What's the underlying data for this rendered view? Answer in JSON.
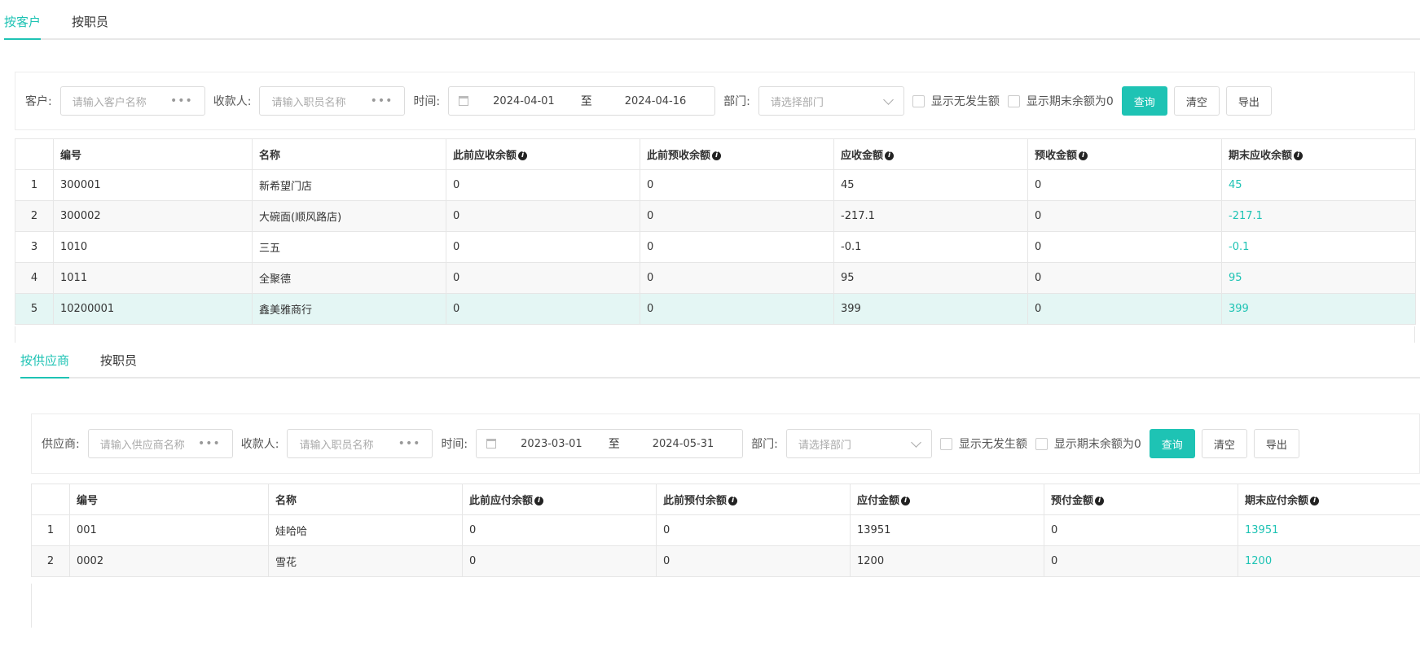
{
  "top": {
    "tabs": [
      "按客户",
      "按职员"
    ],
    "filter": {
      "customer_label": "客户:",
      "customer_placeholder": "请输入客户名称",
      "collector_label": "收款人:",
      "collector_placeholder": "请输入职员名称",
      "time_label": "时间:",
      "date_start": "2024-04-01",
      "date_sep": "至",
      "date_end": "2024-04-16",
      "dept_label": "部门:",
      "dept_placeholder": "请选择部门",
      "chk_no_activity": "显示无发生额",
      "chk_zero_end": "显示期末余额为0",
      "btn_query": "查询",
      "btn_clear": "清空",
      "btn_export": "导出"
    },
    "columns": [
      "编号",
      "名称",
      "此前应收余额",
      "此前预收余额",
      "应收金额",
      "预收金额",
      "期末应收余额"
    ],
    "rows": [
      {
        "idx": "1",
        "code": "300001",
        "name": "新希望门店",
        "prev_ar": "0",
        "prev_adv": "0",
        "amount": "45",
        "adv": "0",
        "end": "45"
      },
      {
        "idx": "2",
        "code": "300002",
        "name": "大碗面(顺风路店)",
        "prev_ar": "0",
        "prev_adv": "0",
        "amount": "-217.1",
        "adv": "0",
        "end": "-217.1"
      },
      {
        "idx": "3",
        "code": "1010",
        "name": "三五",
        "prev_ar": "0",
        "prev_adv": "0",
        "amount": "-0.1",
        "adv": "0",
        "end": "-0.1"
      },
      {
        "idx": "4",
        "code": "1011",
        "name": "全聚德",
        "prev_ar": "0",
        "prev_adv": "0",
        "amount": "95",
        "adv": "0",
        "end": "95"
      },
      {
        "idx": "5",
        "code": "10200001",
        "name": "鑫美雅商行",
        "prev_ar": "0",
        "prev_adv": "0",
        "amount": "399",
        "adv": "0",
        "end": "399"
      }
    ]
  },
  "bottom": {
    "tabs": [
      "按供应商",
      "按职员"
    ],
    "filter": {
      "supplier_label": "供应商:",
      "supplier_placeholder": "请输入供应商名称",
      "collector_label": "收款人:",
      "collector_placeholder": "请输入职员名称",
      "time_label": "时间:",
      "date_start": "2023-03-01",
      "date_sep": "至",
      "date_end": "2024-05-31",
      "dept_label": "部门:",
      "dept_placeholder": "请选择部门",
      "chk_no_activity": "显示无发生额",
      "chk_zero_end": "显示期末余额为0",
      "btn_query": "查询",
      "btn_clear": "清空",
      "btn_export": "导出"
    },
    "columns": [
      "编号",
      "名称",
      "此前应付余额",
      "此前预付余额",
      "应付金额",
      "预付金额",
      "期末应付余额"
    ],
    "rows": [
      {
        "idx": "1",
        "code": "001",
        "name": "娃哈哈",
        "prev_ap": "0",
        "prev_adv": "0",
        "amount": "13951",
        "adv": "0",
        "end": "13951"
      },
      {
        "idx": "2",
        "code": "0002",
        "name": "雪花",
        "prev_ap": "0",
        "prev_adv": "0",
        "amount": "1200",
        "adv": "0",
        "end": "1200"
      }
    ]
  },
  "icons": {
    "info": "i",
    "dots": "•••"
  },
  "colors": {
    "accent": "#1ec3b4",
    "selected_row": "#e4f6f4"
  }
}
